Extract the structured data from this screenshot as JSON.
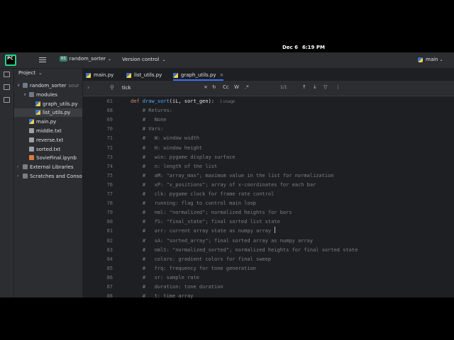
{
  "menubar": {
    "date": "Dec 6",
    "time": "6:19 PM"
  },
  "titlebar": {
    "logo": "PC",
    "project_badge": "RS",
    "project_name": "random_sorter",
    "vcs": "Version control",
    "run_config": "main"
  },
  "project_panel": {
    "title": "Project",
    "items": [
      {
        "label": "random_sorter",
        "suffix": "sour",
        "type": "folder",
        "depth": 0,
        "expanded": true
      },
      {
        "label": "modules",
        "type": "folder",
        "depth": 1,
        "expanded": true
      },
      {
        "label": "graph_utils.py",
        "type": "py",
        "depth": 2
      },
      {
        "label": "list_utils.py",
        "type": "py",
        "depth": 2,
        "selected": true
      },
      {
        "label": "main.py",
        "type": "py",
        "depth": 1
      },
      {
        "label": "middle.txt",
        "type": "txt",
        "depth": 1
      },
      {
        "label": "reverse.txt",
        "type": "txt",
        "depth": 1
      },
      {
        "label": "sorted.txt",
        "type": "txt",
        "depth": 1
      },
      {
        "label": "SovieFinal.ipynb",
        "type": "nb",
        "depth": 1
      },
      {
        "label": "External Libraries",
        "type": "lib",
        "depth": 0
      },
      {
        "label": "Scratches and Consoles",
        "type": "lib",
        "depth": 0
      }
    ]
  },
  "editor": {
    "tabs": [
      {
        "label": "main.py",
        "active": false
      },
      {
        "label": "list_utils.py",
        "active": false
      },
      {
        "label": "graph_utils.py",
        "active": true
      }
    ],
    "find": {
      "query": "tick",
      "match_case": "Cc",
      "words": "W",
      "regex": ".*",
      "count": "1/1"
    },
    "lines": [
      {
        "n": "61",
        "parts": [
          [
            "kw",
            "def "
          ],
          [
            "fn",
            "draw_sort"
          ],
          [
            "",
            "(iL, sort_gen):"
          ]
        ],
        "usage": "1 usage"
      },
      {
        "n": "68",
        "parts": [
          [
            "cmt",
            "    # Returns:"
          ]
        ]
      },
      {
        "n": "69",
        "parts": [
          [
            "cmt",
            "    #   None"
          ]
        ]
      },
      {
        "n": "70",
        "parts": [
          [
            "cmt",
            "    # Vars:"
          ]
        ]
      },
      {
        "n": "71",
        "parts": [
          [
            "cmt",
            "    #   W: window width"
          ]
        ]
      },
      {
        "n": "72",
        "parts": [
          [
            "cmt",
            "    #   H: window height"
          ]
        ]
      },
      {
        "n": "73",
        "parts": [
          [
            "cmt",
            "    #   win: pygame display surface"
          ]
        ]
      },
      {
        "n": "74",
        "parts": [
          [
            "cmt",
            "    #   n: length of the list"
          ]
        ]
      },
      {
        "n": "75",
        "parts": [
          [
            "cmt",
            "    #   aM: \"array_max\"; maximum value in the list for normalization"
          ]
        ]
      },
      {
        "n": "76",
        "parts": [
          [
            "cmt",
            "    #   xP: \"x_positions\"; array of x-coordinates for each bar"
          ]
        ]
      },
      {
        "n": "77",
        "parts": [
          [
            "cmt",
            "    #   clk: pygame clock for frame rate control"
          ]
        ]
      },
      {
        "n": "78",
        "parts": [
          [
            "cmt",
            "    #   running: flag to control main loop"
          ]
        ]
      },
      {
        "n": "79",
        "parts": [
          [
            "cmt",
            "    #   nml: \"normalized\"; normalized heights for bars"
          ]
        ]
      },
      {
        "n": "80",
        "parts": [
          [
            "cmt",
            "    #   fS: \"final_state\"; final sorted list state"
          ]
        ]
      },
      {
        "n": "81",
        "parts": [
          [
            "cmt",
            "    #   arr: current array state as numpy array"
          ]
        ]
      },
      {
        "n": "82",
        "parts": [
          [
            "cmt",
            "    #   sA: \"sorted_array\"; final sorted array as numpy array"
          ]
        ]
      },
      {
        "n": "83",
        "parts": [
          [
            "cmt",
            "    #   nmlS: \"normalized_sorted\"; normalized heights for final sorted state"
          ]
        ]
      },
      {
        "n": "84",
        "parts": [
          [
            "cmt",
            "    #   colors: gradient colors for final sweep"
          ]
        ]
      },
      {
        "n": "85",
        "parts": [
          [
            "cmt",
            "    #   frq: frequency for tone generation"
          ]
        ]
      },
      {
        "n": "86",
        "parts": [
          [
            "cmt",
            "    #   sr: sample rate"
          ]
        ]
      },
      {
        "n": "87",
        "parts": [
          [
            "cmt",
            "    #   duration: tone duration"
          ]
        ]
      },
      {
        "n": "88",
        "parts": [
          [
            "cmt",
            "    #   t: time array"
          ]
        ]
      }
    ]
  }
}
